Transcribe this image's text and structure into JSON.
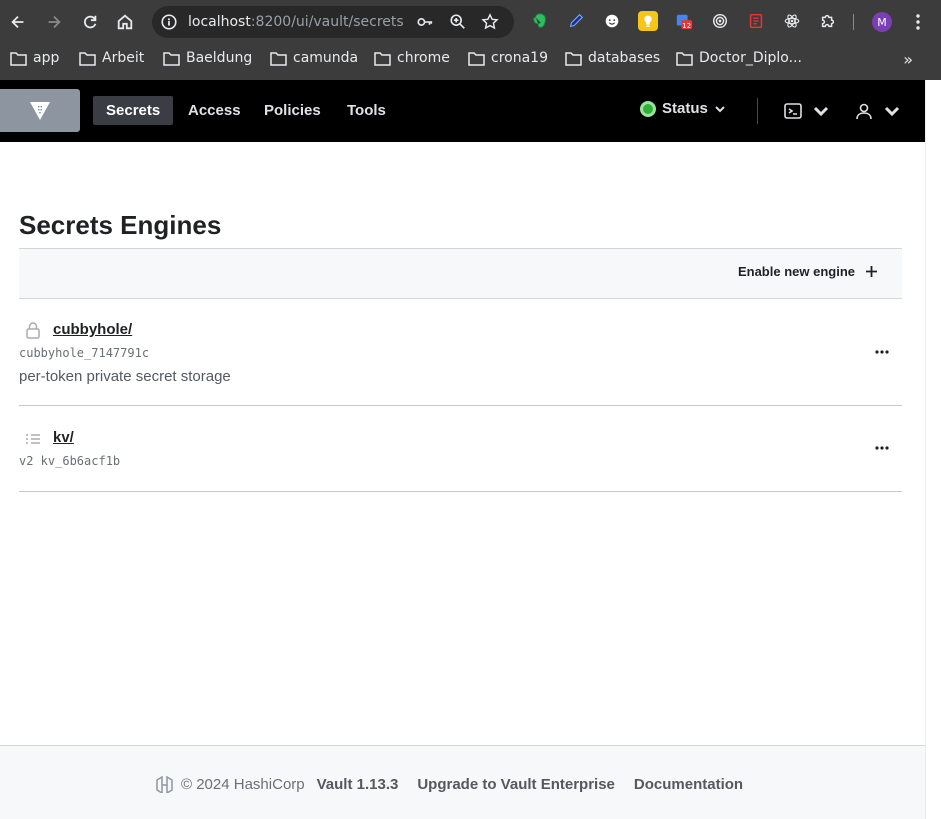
{
  "browser": {
    "url_host": "localhost",
    "url_path": ":8200/ui/vault/secrets",
    "profile_initial": "M",
    "ext_badge": "12",
    "bookmarks": [
      "app",
      "Arbeit",
      "Baeldung",
      "camunda",
      "chrome",
      "crona19",
      "databases",
      "Doctor_Diplo..."
    ],
    "bookmarks_more": "»"
  },
  "header": {
    "nav": [
      "Secrets",
      "Access",
      "Policies",
      "Tools"
    ],
    "status_label": "Status",
    "status_color": "#2eb039"
  },
  "main": {
    "title": "Secrets Engines",
    "enable_label": "Enable new engine",
    "engines": [
      {
        "name": "cubbyhole/",
        "icon": "lock-icon",
        "accessor": "cubbyhole_7147791c",
        "description": "per-token private secret storage"
      },
      {
        "name": "kv/",
        "icon": "list-icon",
        "accessor": "v2 kv_6b6acf1b",
        "description": ""
      }
    ]
  },
  "footer": {
    "copyright": "© 2024 HashiCorp",
    "version": "Vault 1.13.3",
    "upgrade": "Upgrade to Vault Enterprise",
    "docs": "Documentation"
  }
}
